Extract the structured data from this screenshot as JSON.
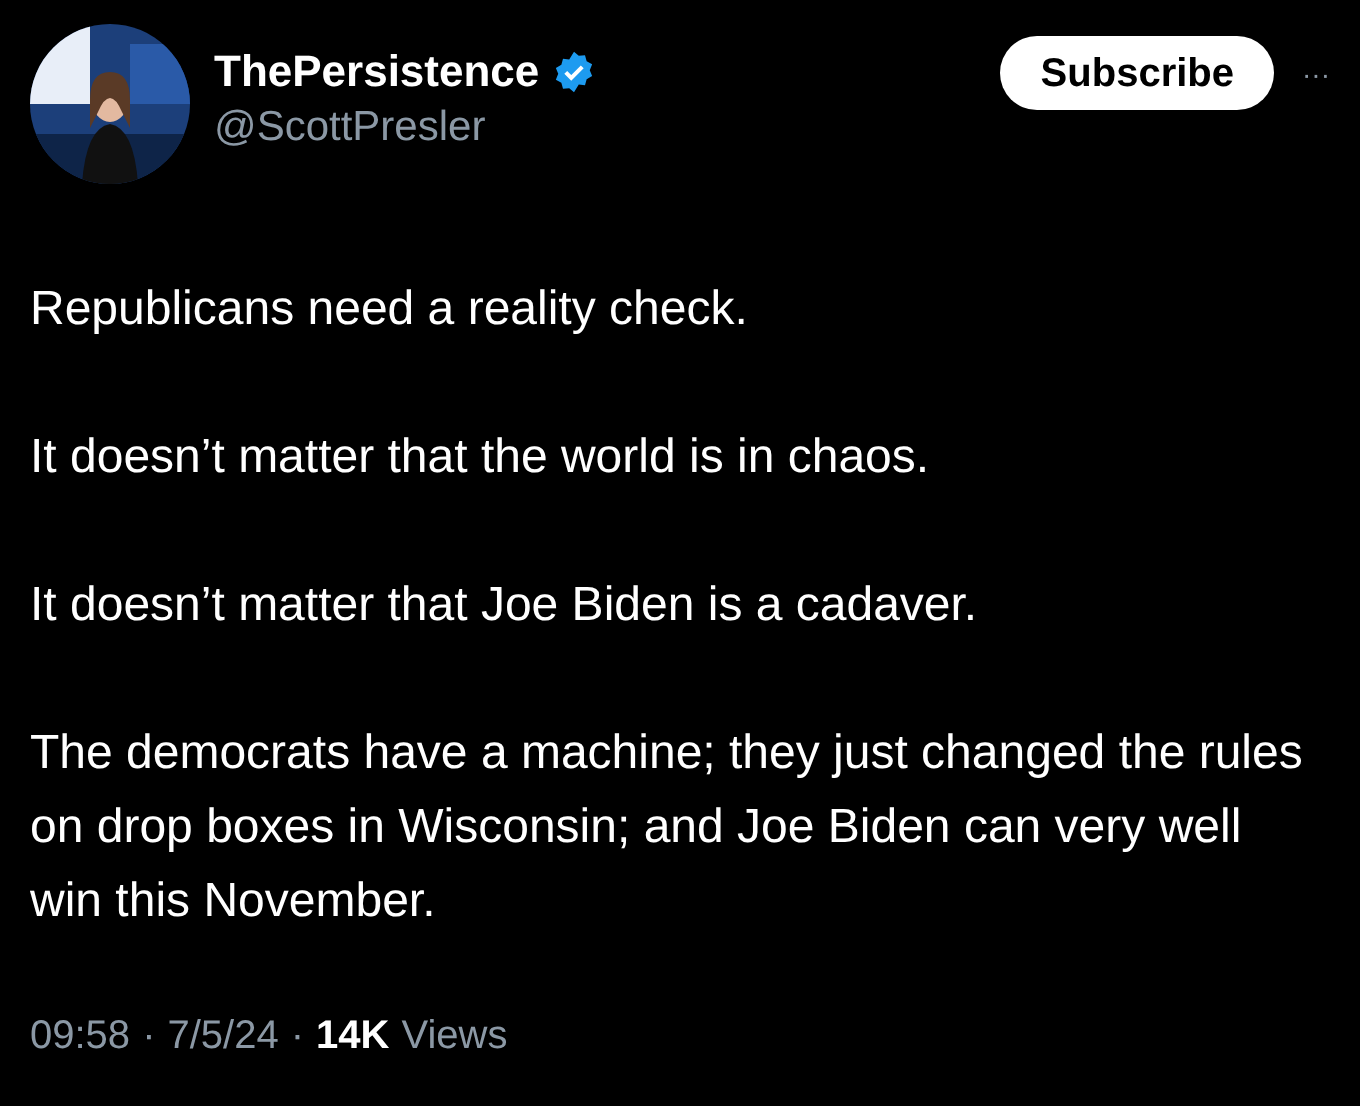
{
  "author": {
    "name": "ThePersistence",
    "verified": true,
    "handle": "@ScottPresler"
  },
  "subscribe_button": "Subscribe",
  "more_button": "···",
  "paragraphs": [
    "Republicans need a reality check.",
    "It doesn’t matter that the world is in chaos.",
    "It doesn’t matter that Joe Biden is a cadaver.",
    "The democrats have a machine; they just changed the rules on drop boxes in Wisconsin; and Joe Biden can very well win this November."
  ],
  "meta": {
    "time": "09:58",
    "separator_1": "·",
    "date": "7/5/24",
    "separator_2": "·",
    "views_count": "14K",
    "views_label": "Views"
  }
}
